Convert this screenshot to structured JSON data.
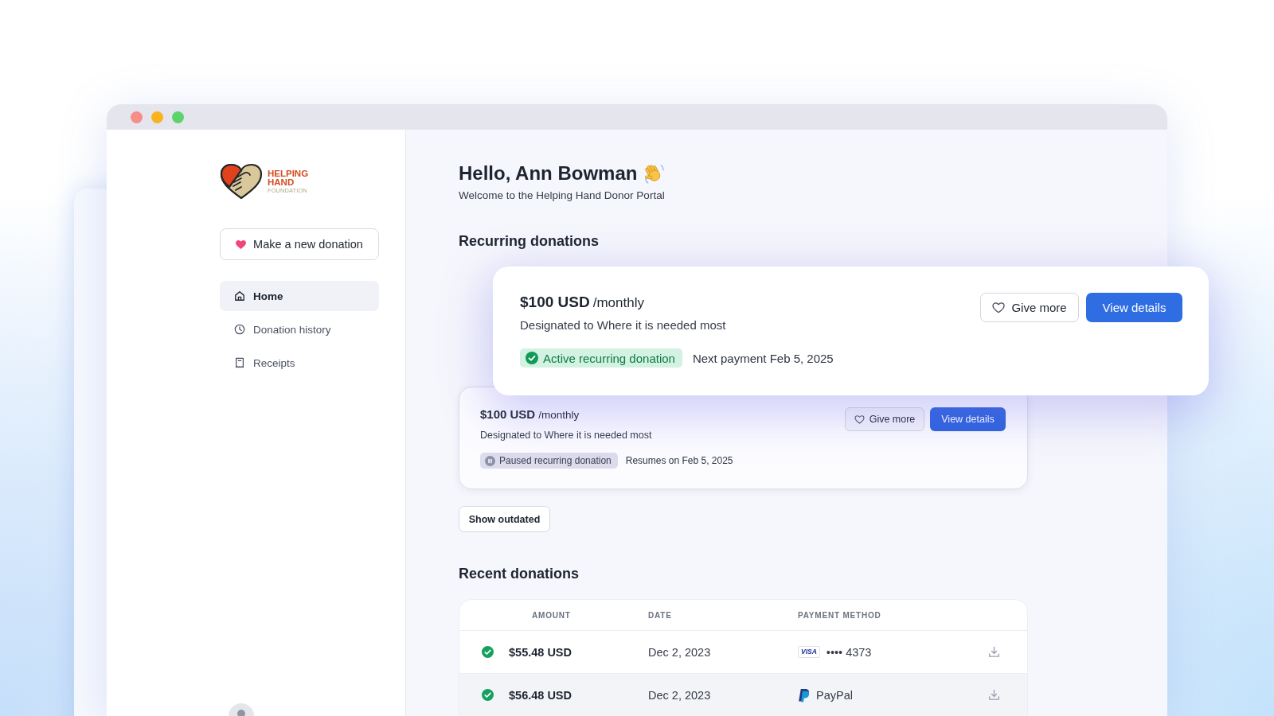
{
  "window": {
    "controls": [
      {
        "color": "#f88c86"
      },
      {
        "color": "#f8b31f"
      },
      {
        "color": "#5dd46b"
      }
    ]
  },
  "sidebar": {
    "logo": {
      "name_lines": [
        "HELPING",
        "HAND"
      ],
      "tagline": "FOUNDATION"
    },
    "new_donation_button": "Make a new donation",
    "items": [
      {
        "kind": "home",
        "label": "Home",
        "selected": true
      },
      {
        "kind": "history",
        "label": "Donation history",
        "selected": false
      },
      {
        "kind": "receipts",
        "label": "Receipts",
        "selected": false
      }
    ]
  },
  "main": {
    "greeting": "Hello, Ann Bowman",
    "subtitle": "Welcome to the Helping Hand Donor Portal",
    "recurring": {
      "title": "Recurring donations",
      "items": [
        {
          "raised": true,
          "amount": "$100 USD",
          "period": "/monthly",
          "designation": "Designated to Where it is needed most",
          "status": {
            "kind": "active",
            "label": "Active recurring donation"
          },
          "schedule": "Next payment Feb 5, 2025",
          "give_more": "Give more",
          "view_details": "View details"
        },
        {
          "raised": false,
          "amount": "$100 USD",
          "period": "/monthly",
          "designation": "Designated to Where it is needed most",
          "status": {
            "kind": "paused",
            "label": "Paused recurring donation"
          },
          "schedule": "Resumes on Feb 5, 2025",
          "give_more": "Give more",
          "view_details": "View details"
        }
      ],
      "show_outdated": "Show outdated"
    },
    "recent": {
      "title": "Recent donations",
      "columns": [
        "AMOUNT",
        "DATE",
        "PAYMENT METHOD"
      ],
      "rows": [
        {
          "highlighted": false,
          "amount": "$55.48 USD",
          "date": "Dec 2, 2023",
          "payment": {
            "kind": "card",
            "brand": "VISA",
            "text": "•••• 4373"
          }
        },
        {
          "highlighted": true,
          "amount": "$56.48 USD",
          "date": "Dec 2, 2023",
          "payment": {
            "kind": "wallet",
            "text": "PayPal"
          }
        }
      ]
    }
  }
}
